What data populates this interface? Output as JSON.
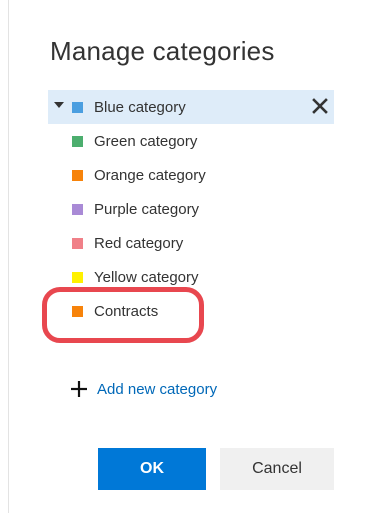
{
  "panel": {
    "title": "Manage categories"
  },
  "categories": [
    {
      "label": "Blue category",
      "color": "#4a9ee0",
      "selected": true
    },
    {
      "label": "Green category",
      "color": "#4cae6e"
    },
    {
      "label": "Orange category",
      "color": "#f7830a"
    },
    {
      "label": "Purple category",
      "color": "#a98ad6"
    },
    {
      "label": "Red category",
      "color": "#f08088"
    },
    {
      "label": "Yellow category",
      "color": "#fff100"
    },
    {
      "label": "Contracts",
      "color": "#f7830a"
    }
  ],
  "add_category": {
    "label": "Add new category",
    "link_color": "#0068b8"
  },
  "buttons": {
    "ok_label": "OK",
    "cancel_label": "Cancel",
    "ok_color": "#0078d7"
  },
  "highlight_color": "#e8474f"
}
